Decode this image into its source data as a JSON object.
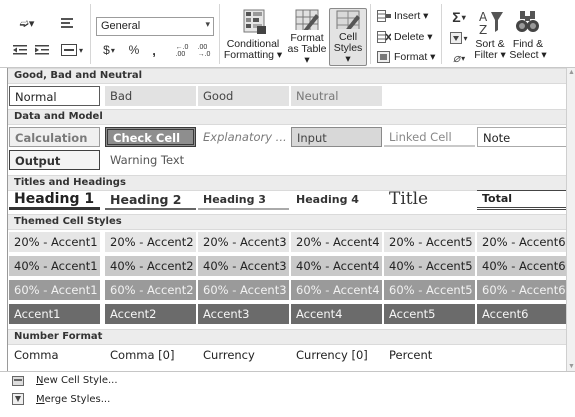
{
  "ribbon": {
    "number_format": "General",
    "currency_symbol": "$",
    "percent_symbol": "%",
    "comma_symbol": ",",
    "increase_decimal": "←.0\n.00",
    "decrease_decimal": ".00\n→.0",
    "conditional_formatting": [
      "Conditional",
      "Formatting ▾"
    ],
    "format_as_table": [
      "Format",
      "as Table ▾"
    ],
    "cell_styles": [
      "Cell",
      "Styles ▾"
    ],
    "insert": "Insert ▾",
    "delete": "Delete ▾",
    "format": "Format ▾",
    "sigma": "Σ",
    "sort_filter": [
      "Sort &",
      "Filter ▾"
    ],
    "find_select": [
      "Find &",
      "Select ▾"
    ]
  },
  "sections": {
    "good_bad": "Good, Bad and Neutral",
    "data_model": "Data and Model",
    "titles": "Titles and Headings",
    "themed": "Themed Cell Styles",
    "number_format": "Number Format"
  },
  "good_bad": [
    "Normal",
    "Bad",
    "Good",
    "Neutral"
  ],
  "data_model_row1": [
    "Calculation",
    "Check Cell",
    "Explanatory ...",
    "Input",
    "Linked Cell",
    "Note"
  ],
  "data_model_row2": [
    "Output",
    "Warning Text"
  ],
  "titles": [
    "Heading 1",
    "Heading 2",
    "Heading 3",
    "Heading 4",
    "Title",
    "Total"
  ],
  "themed": {
    "row20": [
      "20% - Accent1",
      "20% - Accent2",
      "20% - Accent3",
      "20% - Accent4",
      "20% - Accent5",
      "20% - Accent6"
    ],
    "row40": [
      "40% - Accent1",
      "40% - Accent2",
      "40% - Accent3",
      "40% - Accent4",
      "40% - Accent5",
      "40% - Accent6"
    ],
    "row60": [
      "60% - Accent1",
      "60% - Accent2",
      "60% - Accent3",
      "60% - Accent4",
      "60% - Accent5",
      "60% - Accent6"
    ],
    "accent": [
      "Accent1",
      "Accent2",
      "Accent3",
      "Accent4",
      "Accent5",
      "Accent6"
    ]
  },
  "number_formats": [
    "Comma",
    "Comma [0]",
    "Currency",
    "Currency [0]",
    "Percent"
  ],
  "commands": {
    "new_cell_style": [
      "N",
      "ew Cell Style..."
    ],
    "merge_styles": [
      "M",
      "erge Styles..."
    ]
  }
}
